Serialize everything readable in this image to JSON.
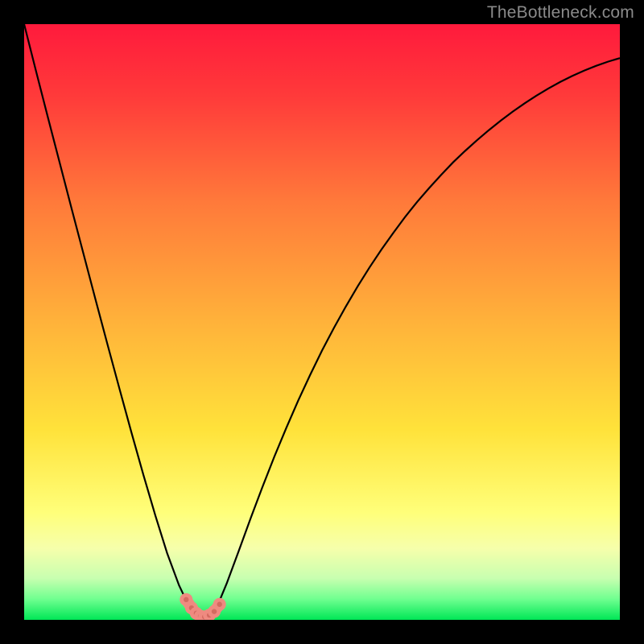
{
  "watermark": "TheBottleneck.com",
  "colors": {
    "black": "#000000",
    "curve": "#000000",
    "marker_fill": "#ef8a80",
    "marker_dot": "#d46a60",
    "green": "#00e756",
    "yellow": "#ffff7a",
    "red_top": "#ff1a3c",
    "red_mid": "#ff6a3a"
  },
  "chart_data": {
    "type": "line",
    "title": "",
    "xlabel": "",
    "ylabel": "",
    "xlim": [
      0,
      100
    ],
    "ylim": [
      0,
      100
    ],
    "x": [
      0,
      2,
      4,
      6,
      8,
      10,
      12,
      14,
      16,
      18,
      20,
      22,
      24,
      26,
      27,
      28,
      28.5,
      29,
      29.5,
      30,
      30.5,
      31,
      31.5,
      32,
      33,
      34,
      36,
      38,
      40,
      42,
      44,
      46,
      48,
      50,
      52,
      54,
      56,
      58,
      60,
      62,
      64,
      66,
      68,
      70,
      72,
      74,
      76,
      78,
      80,
      82,
      84,
      86,
      88,
      90,
      92,
      94,
      96,
      98,
      100
    ],
    "y": [
      100,
      92.1,
      84.3,
      76.6,
      68.9,
      61.3,
      53.7,
      46.2,
      38.8,
      31.5,
      24.4,
      17.6,
      11.2,
      5.8,
      3.7,
      2.1,
      1.5,
      1.0,
      0.7,
      0.5,
      0.6,
      0.8,
      1.2,
      1.9,
      3.7,
      6.1,
      11.5,
      17.0,
      22.3,
      27.4,
      32.2,
      36.8,
      41.1,
      45.2,
      49.0,
      52.6,
      56.0,
      59.2,
      62.2,
      65.0,
      67.7,
      70.2,
      72.5,
      74.7,
      76.8,
      78.7,
      80.5,
      82.2,
      83.8,
      85.3,
      86.7,
      88.0,
      89.2,
      90.3,
      91.3,
      92.2,
      93.0,
      93.7,
      94.3
    ],
    "markers_x": [
      27.2,
      28.1,
      28.9,
      29.6,
      30.3,
      31.1,
      31.9,
      32.8
    ],
    "markers_y": [
      3.4,
      2.0,
      1.1,
      0.6,
      0.5,
      0.8,
      1.4,
      2.6
    ],
    "gradient_stops": [
      {
        "pos": 0.0,
        "color": "#ff1a3c"
      },
      {
        "pos": 0.12,
        "color": "#ff3a3a"
      },
      {
        "pos": 0.3,
        "color": "#ff7a3a"
      },
      {
        "pos": 0.5,
        "color": "#ffb23a"
      },
      {
        "pos": 0.68,
        "color": "#ffe23a"
      },
      {
        "pos": 0.82,
        "color": "#ffff7a"
      },
      {
        "pos": 0.88,
        "color": "#f6ffab"
      },
      {
        "pos": 0.93,
        "color": "#c8ffb0"
      },
      {
        "pos": 0.965,
        "color": "#70ff90"
      },
      {
        "pos": 1.0,
        "color": "#00e756"
      }
    ]
  }
}
